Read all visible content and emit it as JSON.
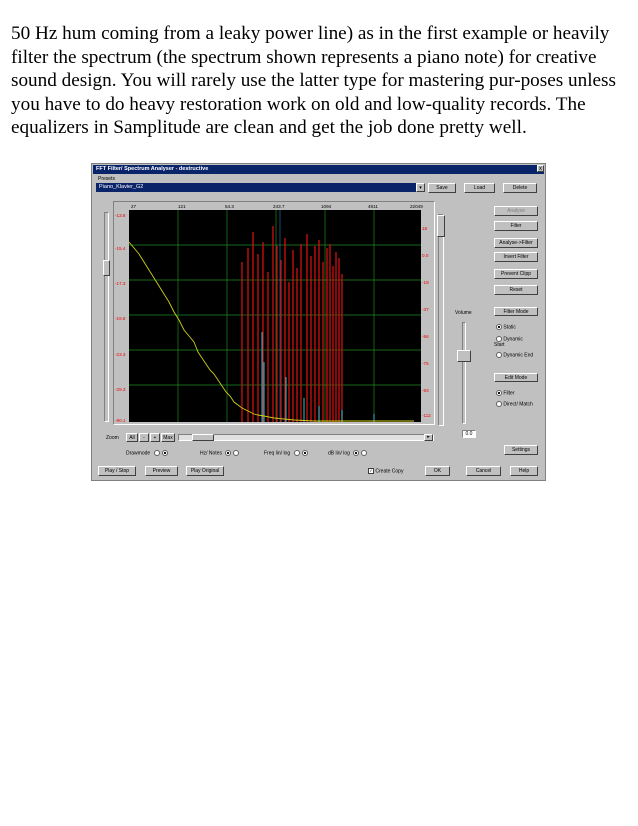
{
  "page": {
    "paragraph": "50 Hz hum coming from a leaky power line) as in the first example or heavily filter the spectrum (the spectrum shown represents a piano note) for creative sound design. You will rarely use the latter type for mastering pur-poses unless you have to do heavy restoration work on old and low-quality records. The equalizers in Samplitude are clean and get the job done pretty well."
  },
  "window": {
    "title": "FFT Filter/ Spectrum Analyser - destructive",
    "close": "x",
    "presets_label": "Presets",
    "preset_value": "Piano_Klavier_G2",
    "save": "Save",
    "load": "Load",
    "delete": "Delete",
    "x_ticks": [
      "27",
      "121",
      "54.3",
      "243.7",
      "1094",
      "4911",
      "22049"
    ],
    "left_ticks": [
      "-13.8",
      "-15.4",
      "-17.3",
      "-19.8",
      "-23.3",
      "-29.3",
      "-90.1"
    ],
    "right_ticks": [
      "18",
      "0.0",
      "-18",
      "-37",
      "-56",
      "-75",
      "-93",
      "-112"
    ],
    "side_buttons": {
      "analyse": "Analyse",
      "filter": "Filter",
      "analyse_filter": "Analyse->Filter",
      "invert_filter": "Invert Filter",
      "prevent_clipp": "Prevent Clipp",
      "reset": "Reset"
    },
    "filter_mode": {
      "title": "Filter Mode",
      "static": "Static",
      "dynamic_start": "Dynamic Start",
      "dynamic_end": "Dynamic End"
    },
    "edit_mode": {
      "title": "Edit Mode",
      "filter": "Filter",
      "direct_match": "Direct/ Match"
    },
    "volume_label": "Volume",
    "volume_value": "0.0",
    "zoom": {
      "label": "Zoom",
      "all": "All",
      "minus": "-",
      "plus": "+",
      "max": "Max"
    },
    "drawmode": "Drawmode",
    "hz_notes": "Hz/ Notes",
    "freq_lin_log": "Freq lin/ log",
    "db_lin_log": "dB lin/ log",
    "settings": "Settings",
    "play_stop": "Play / Stop",
    "preview": "Preview",
    "play_original": "Play Original",
    "create_copy": "Create Copy",
    "ok": "OK",
    "cancel": "Cancel",
    "help": "Help"
  },
  "colors": {
    "plot_bg": "#000000",
    "grid": "#1f8a1f",
    "analysis_curve": "#cfcf1a",
    "filter_bars": "#d01010",
    "residual_peaks": "#30c0d0"
  }
}
